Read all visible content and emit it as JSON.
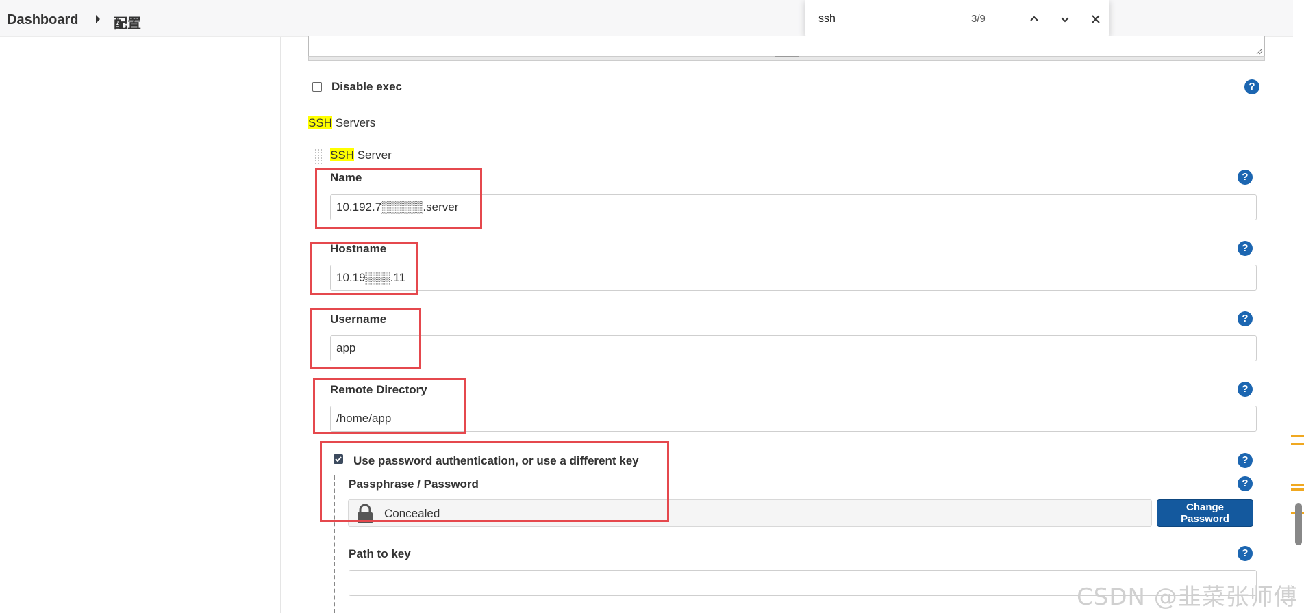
{
  "breadcrumb": {
    "home": "Dashboard",
    "current": "配置"
  },
  "find_bar": {
    "query": "ssh",
    "count": "3/9"
  },
  "disable_exec": {
    "label": "Disable exec",
    "checked": false
  },
  "ssh_servers": {
    "heading_highlight": "SSH",
    "heading_rest": " Servers",
    "item_highlight": "SSH",
    "item_rest": " Server"
  },
  "fields": {
    "name": {
      "label": "Name",
      "value": "10.192.7▒▒▒▒▒.server"
    },
    "hostname": {
      "label": "Hostname",
      "value": "10.19▒▒▒.11"
    },
    "username": {
      "label": "Username",
      "value": "app"
    },
    "remote_directory": {
      "label": "Remote Directory",
      "value": "/home/app"
    }
  },
  "password_auth": {
    "checkbox_label": "Use password authentication, or use a different key",
    "checked": true,
    "passphrase_label": "Passphrase / Password",
    "concealed_text": "Concealed",
    "change_button": "Change Password"
  },
  "path_to_key": {
    "label": "Path to key",
    "value": ""
  },
  "help_icon_glyph": "?",
  "watermark": "CSDN @韭菜张师傅",
  "colors": {
    "accent": "#1c66b1",
    "button": "#14599e",
    "highlight": "#ffff00",
    "annotation_red": "#e5484d"
  }
}
